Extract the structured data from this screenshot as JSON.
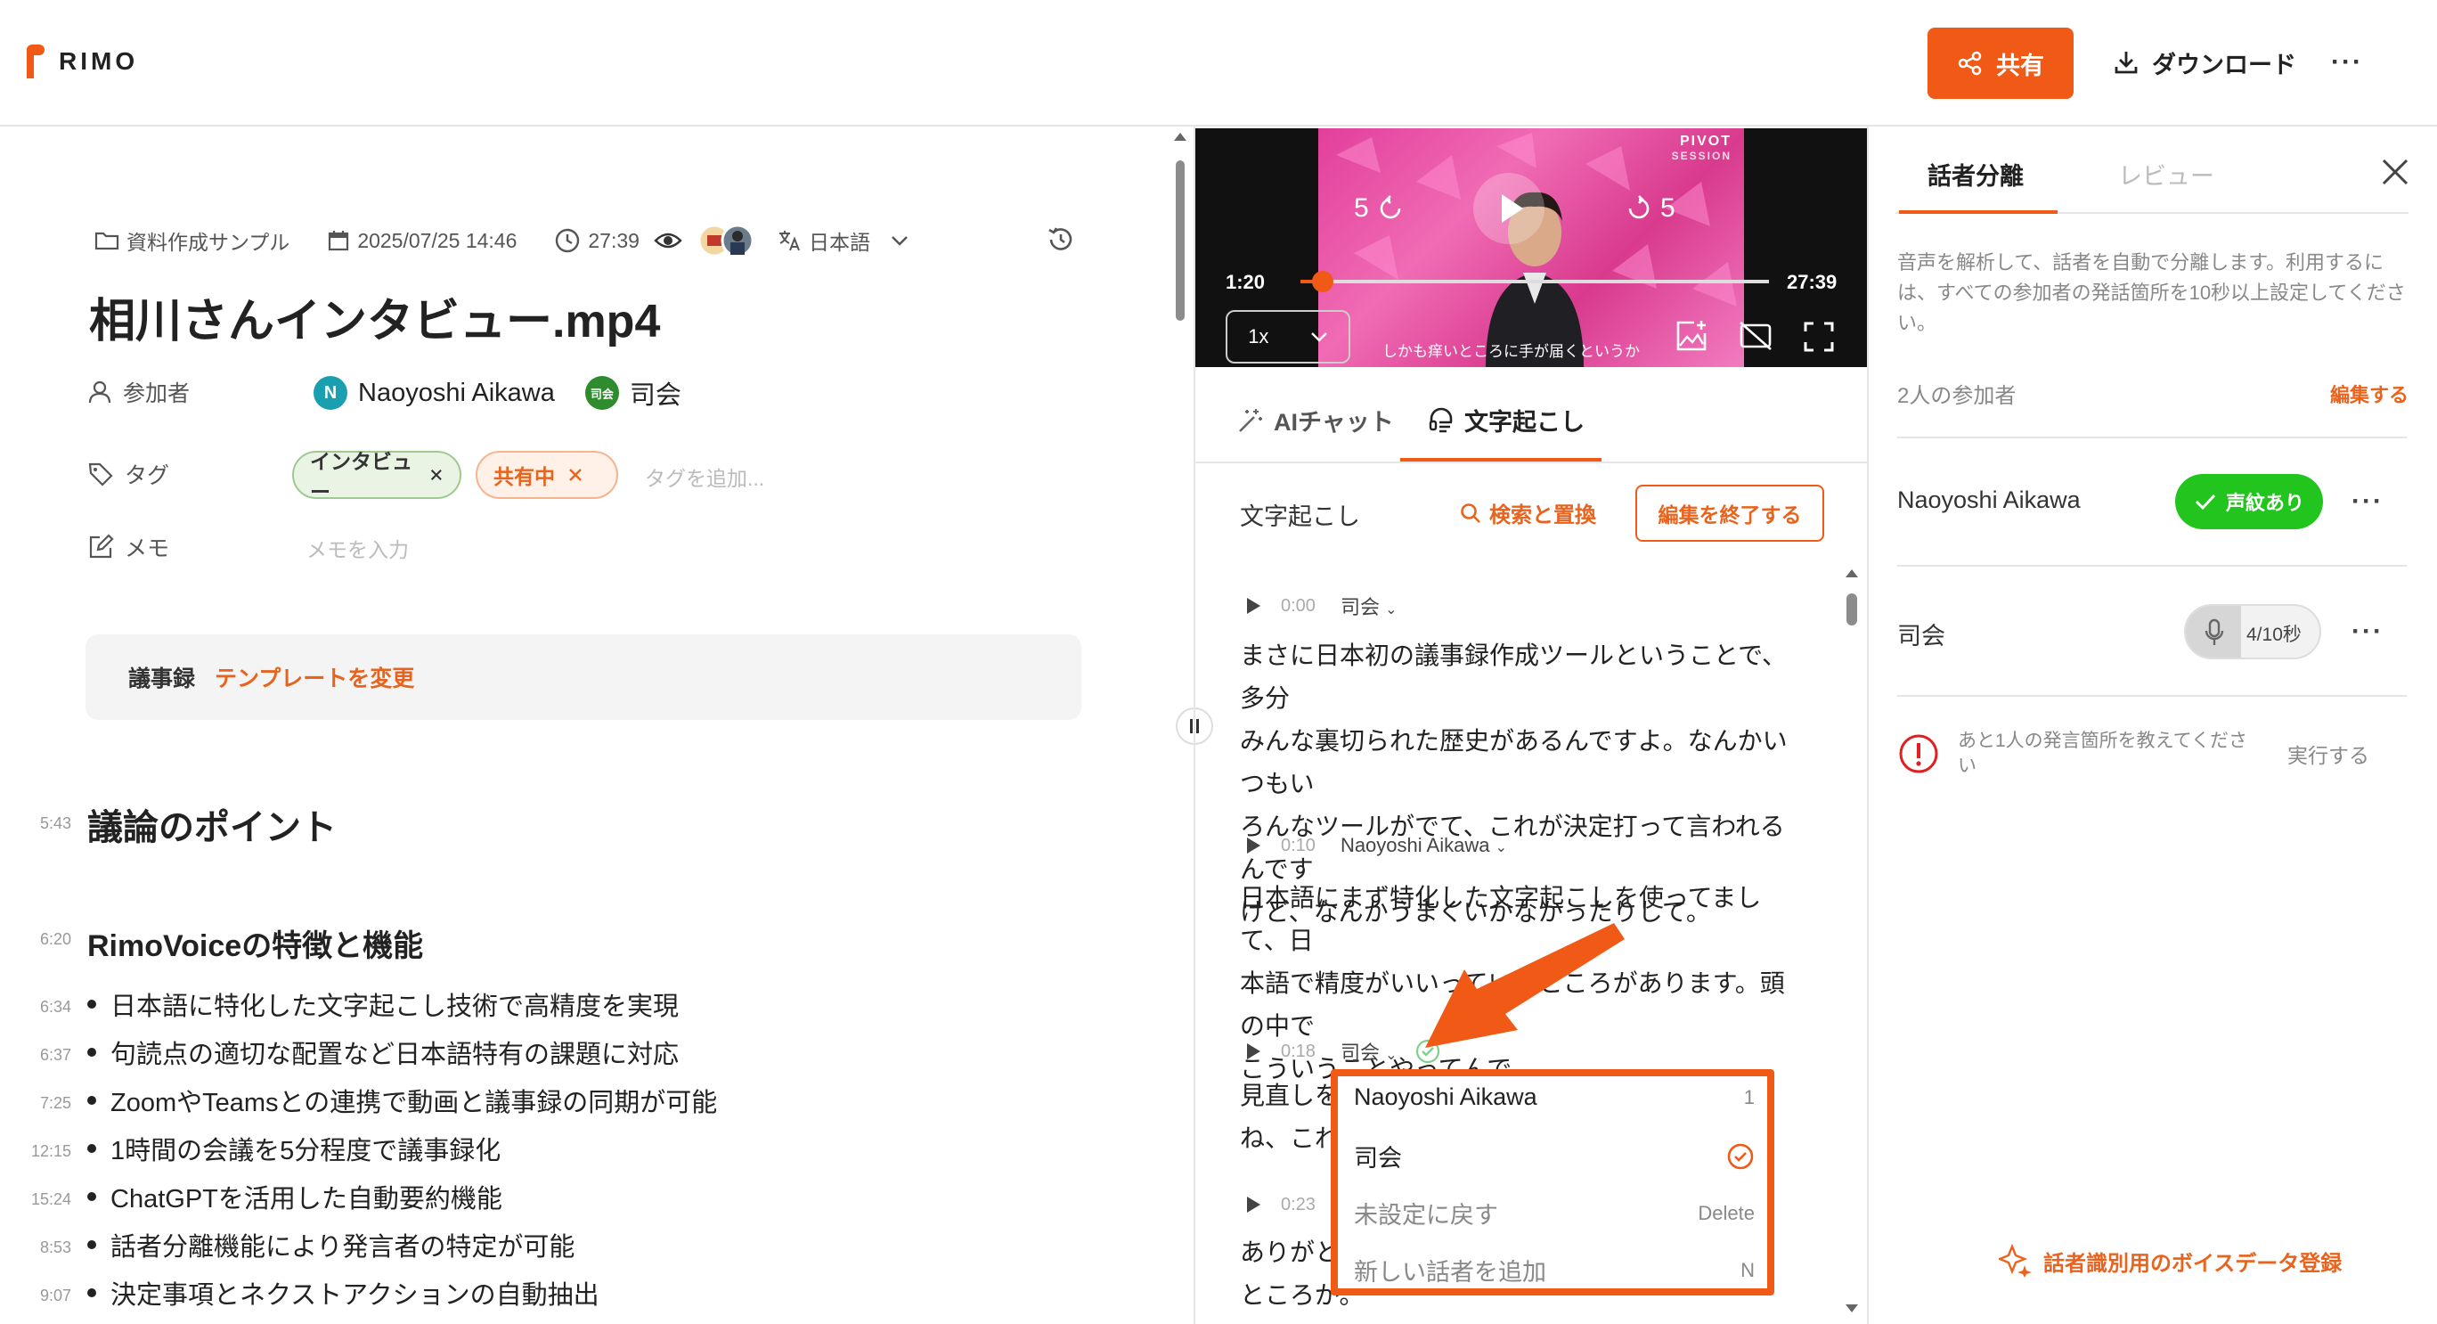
{
  "header": {
    "logo_text": "RIMO",
    "share_label": "共有",
    "download_label": "ダウンロード",
    "more_label": "···"
  },
  "meta": {
    "folder": "資料作成サンプル",
    "datetime": "2025/07/25 14:46",
    "duration": "27:39",
    "language": "日本語"
  },
  "title": "相川さんインタビュー.mp4",
  "participants": {
    "label": "参加者",
    "items": [
      {
        "name": "Naoyoshi Aikawa",
        "avatar": "N",
        "color": "#1a9fb0"
      },
      {
        "name": "司会",
        "avatar": "司会",
        "color": "#2e8b2e"
      }
    ]
  },
  "tags": {
    "label": "タグ",
    "items": [
      "インタビュー",
      "共有中"
    ],
    "add_placeholder": "タグを追加..."
  },
  "memo": {
    "label": "メモ",
    "placeholder": "メモを入力"
  },
  "minutes": {
    "label": "議事録",
    "change_template": "テンプレートを変更"
  },
  "outline": {
    "h1": {
      "ts": "5:43",
      "text": "議論のポイント"
    },
    "h2": {
      "ts": "6:20",
      "text": "RimoVoiceの特徴と機能"
    },
    "bullets": [
      {
        "ts": "6:34",
        "text": "日本語に特化した文字起こし技術で高精度を実現"
      },
      {
        "ts": "6:37",
        "text": "句読点の適切な配置など日本語特有の課題に対応"
      },
      {
        "ts": "7:25",
        "text": "ZoomやTeamsとの連携で動画と議事録の同期が可能"
      },
      {
        "ts": "12:15",
        "text": "1時間の会議を5分程度で議事録化"
      },
      {
        "ts": "15:24",
        "text": "ChatGPTを活用した自動要約機能"
      },
      {
        "ts": "8:53",
        "text": "話者分離機能により発言者の特定が可能"
      },
      {
        "ts": "9:07",
        "text": "決定事項とネクストアクションの自動抽出"
      }
    ]
  },
  "player": {
    "current": "1:20",
    "total": "27:39",
    "speed": "1x",
    "skip_back": "5",
    "skip_fwd": "5",
    "subtitle": "しかも痒いところに手が届くというか",
    "brand_line1": "PIVOT",
    "brand_line2": "SESSION",
    "progress": 0.048
  },
  "mid_tabs": {
    "ai_chat": "AIチャット",
    "transcript": "文字起こし"
  },
  "transcript": {
    "heading": "文字起こし",
    "search_replace": "検索と置換",
    "end_edit": "編集を終了する",
    "segments": [
      {
        "ts": "0:00",
        "speaker": "司会",
        "lines": [
          "まさに日本初の議事録作成ツールということで、多分",
          "みんな裏切られた歴史があるんですよ。なんかいつもい",
          "ろんなツールがでて、これが決定打って言われるんです",
          "けど、なんかうまくいかなかったりして。"
        ]
      },
      {
        "ts": "0:10",
        "speaker": "Naoyoshi Aikawa",
        "lines": [
          "日本語にまず特化した文字起こしを使ってまして、日",
          "本語で精度がいいっていうところがあります。頭の中で",
          "こういうことやってんで"
        ]
      },
      {
        "ts": "0:18",
        "speaker": "司会",
        "lines": [
          "見直しを",
          "ね、これ。"
        ]
      },
      {
        "ts": "0:23",
        "speaker": "",
        "lines": [
          "ありがとう",
          "ところが。"
        ]
      }
    ]
  },
  "speaker_dropdown": {
    "items": [
      {
        "label": "Naoyoshi Aikawa",
        "shortcut": "1"
      },
      {
        "label": "司会",
        "shortcut": ""
      },
      {
        "label": "未設定に戻す",
        "shortcut": "Delete"
      },
      {
        "label": "新しい話者を追加",
        "shortcut": "N"
      }
    ]
  },
  "right_panel": {
    "tab_diarization": "話者分離",
    "tab_review": "レビュー",
    "description": "音声を解析して、話者を自動で分離します。利用するには、すべての参加者の発話箇所を10秒以上設定してください。",
    "participants_count": "2人の参加者",
    "edit": "編集する",
    "speakers": [
      {
        "name": "Naoyoshi Aikawa",
        "status": "声紋あり"
      },
      {
        "name": "司会",
        "status": "4/10秒",
        "progress": 0.4
      }
    ],
    "warning": "あと1人の発言箇所を教えてください",
    "run": "実行する",
    "voice_register": "話者識別用のボイスデータ登録"
  },
  "colors": {
    "accent": "#f15a16",
    "success": "#22c41e"
  }
}
